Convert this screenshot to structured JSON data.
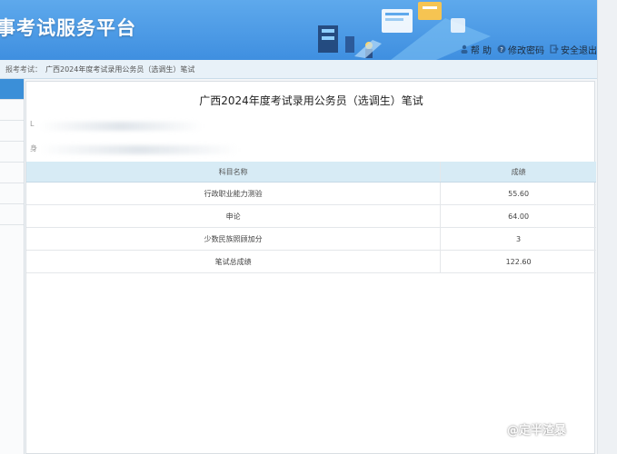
{
  "header": {
    "site_title": "事考试服务平台",
    "links": [
      {
        "label": "帮 助",
        "icon": "user-icon"
      },
      {
        "label": "修改密码",
        "icon": "help-icon"
      },
      {
        "label": "安全退出",
        "icon": "exit-icon"
      }
    ]
  },
  "breadcrumb": {
    "prefix": "报考考试：",
    "path": "广西2024年度考试录用公务员（选调生）笔试"
  },
  "panel": {
    "title": "广西2024年度考试录用公务员（选调生）笔试",
    "info_lines": [
      "L",
      "身"
    ]
  },
  "table": {
    "headers": [
      "科目名称",
      "成绩"
    ],
    "rows": [
      {
        "name": "行政职业能力测验",
        "score": "55.60"
      },
      {
        "name": "申论",
        "score": "64.00"
      },
      {
        "name": "少数民族照顾加分",
        "score": "3"
      },
      {
        "name": "笔试总成绩",
        "score": "122.60"
      }
    ]
  },
  "watermark": {
    "text": "@定半渣暴",
    "icon": "weibo-logo-icon"
  }
}
